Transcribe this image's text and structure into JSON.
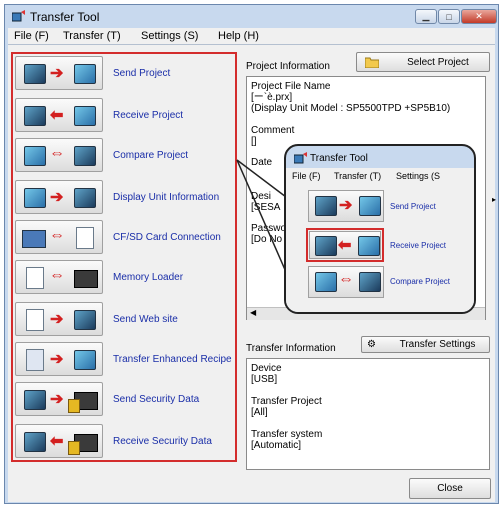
{
  "window": {
    "title": "Transfer Tool"
  },
  "menu": [
    "File (F)",
    "Transfer (T)",
    "Settings (S)",
    "Help (H)"
  ],
  "actions": [
    {
      "label": "Send Project",
      "icon": "send-project-icon"
    },
    {
      "label": "Receive Project",
      "icon": "receive-project-icon"
    },
    {
      "label": "Compare Project",
      "icon": "compare-project-icon"
    },
    {
      "label": "Display Unit Information",
      "icon": "display-unit-info-icon"
    },
    {
      "label": "CF/SD Card Connection",
      "icon": "cf-sd-card-icon"
    },
    {
      "label": "Memory Loader",
      "icon": "memory-loader-icon"
    },
    {
      "label": "Send Web site",
      "icon": "send-web-site-icon"
    },
    {
      "label": "Transfer Enhanced Recipe",
      "icon": "transfer-recipe-icon"
    },
    {
      "label": "Send Security Data",
      "icon": "send-security-icon"
    },
    {
      "label": "Receive Security Data",
      "icon": "receive-security-icon"
    }
  ],
  "project": {
    "group_label": "Project Information",
    "select_button": "Select Project",
    "file_name_label": "Project File Name",
    "file_name_value": "[ー`è.prx]",
    "display_model": "(Display Unit Model : SP5500TPD +SP5B10)",
    "comment_label": "Comment",
    "comment_value": "[]",
    "date_label": "Date",
    "designer_label": "Desi",
    "designer_value": "[SESA",
    "password_label": "Passwo",
    "password_value": "[Do No"
  },
  "transfer": {
    "group_label": "Transfer Information",
    "settings_button": "Transfer Settings",
    "device_label": "Device",
    "device_value": "[USB]",
    "project_label": "Transfer Project",
    "project_value": "[All]",
    "system_label": "Transfer system",
    "system_value": "[Automatic]"
  },
  "close_button": "Close",
  "zoom": {
    "title": "Transfer Tool",
    "menu": [
      "File (F)",
      "Transfer (T)",
      "Settings (S"
    ],
    "items": [
      "Send Project",
      "Receive Project",
      "Compare Project"
    ]
  },
  "colors": {
    "highlight": "#d32c2c",
    "link": "#1a2ea8",
    "chrome": "#c8d9ee"
  }
}
